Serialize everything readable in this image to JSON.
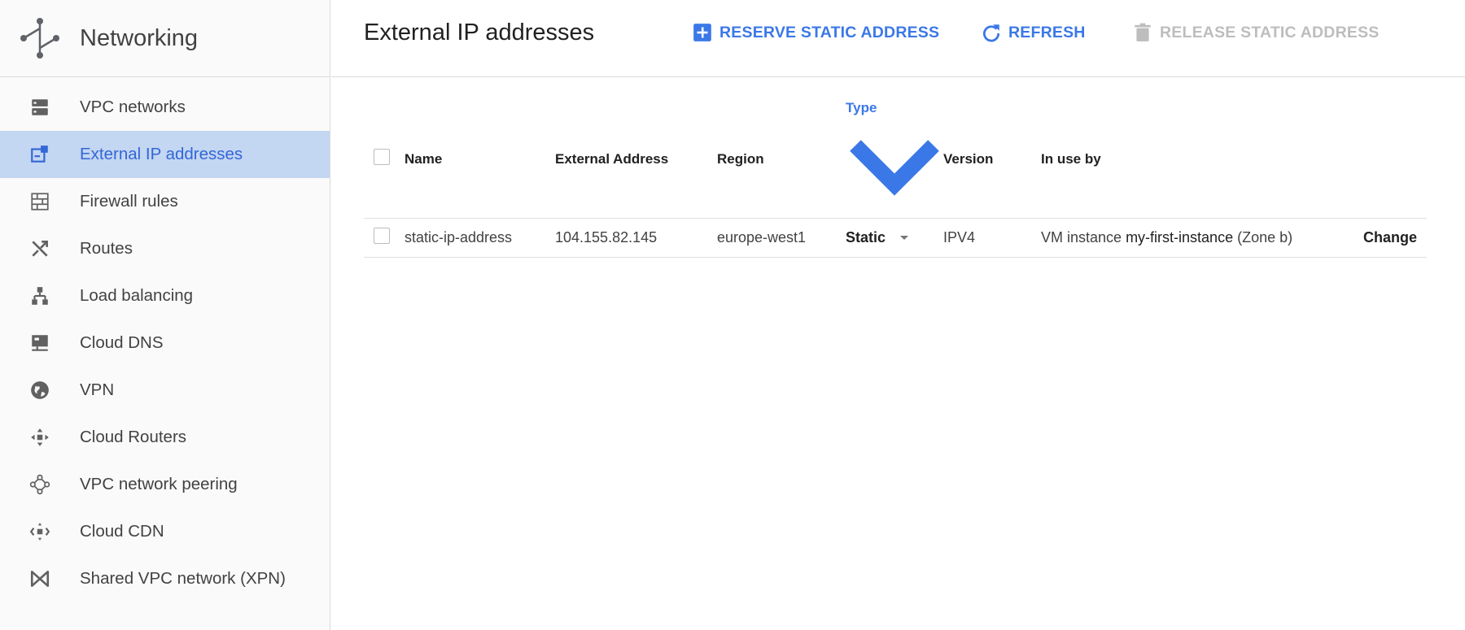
{
  "sidebar": {
    "title": "Networking",
    "logo_icon": "networking-logo-icon",
    "items": [
      {
        "label": "VPC networks",
        "icon": "vpc-networks-icon"
      },
      {
        "label": "External IP addresses",
        "icon": "external-ip-icon",
        "active": true
      },
      {
        "label": "Firewall rules",
        "icon": "firewall-icon"
      },
      {
        "label": "Routes",
        "icon": "routes-icon"
      },
      {
        "label": "Load balancing",
        "icon": "load-balancing-icon"
      },
      {
        "label": "Cloud DNS",
        "icon": "cloud-dns-icon"
      },
      {
        "label": "VPN",
        "icon": "vpn-icon"
      },
      {
        "label": "Cloud Routers",
        "icon": "cloud-routers-icon"
      },
      {
        "label": "VPC network peering",
        "icon": "peering-icon"
      },
      {
        "label": "Cloud CDN",
        "icon": "cloud-cdn-icon"
      },
      {
        "label": "Shared VPC network (XPN)",
        "icon": "shared-vpc-icon"
      }
    ]
  },
  "header": {
    "title": "External IP addresses",
    "reserve_label": "RESERVE STATIC ADDRESS",
    "refresh_label": "REFRESH",
    "release_label": "RELEASE STATIC ADDRESS"
  },
  "table": {
    "columns": {
      "name": "Name",
      "address": "External Address",
      "region": "Region",
      "type": "Type",
      "version": "Version",
      "in_use_by": "In use by"
    },
    "rows": [
      {
        "name": "static-ip-address",
        "address": "104.155.82.145",
        "region": "europe-west1",
        "type": "Static",
        "version": "IPV4",
        "in_use_prefix": "VM instance",
        "in_use_instance": "my-first-instance",
        "in_use_suffix": "(Zone b)",
        "action": "Change"
      }
    ]
  },
  "colors": {
    "accent": "#3b78e7",
    "active_bg": "#c3d6f2",
    "disabled": "#bdbdbd"
  }
}
